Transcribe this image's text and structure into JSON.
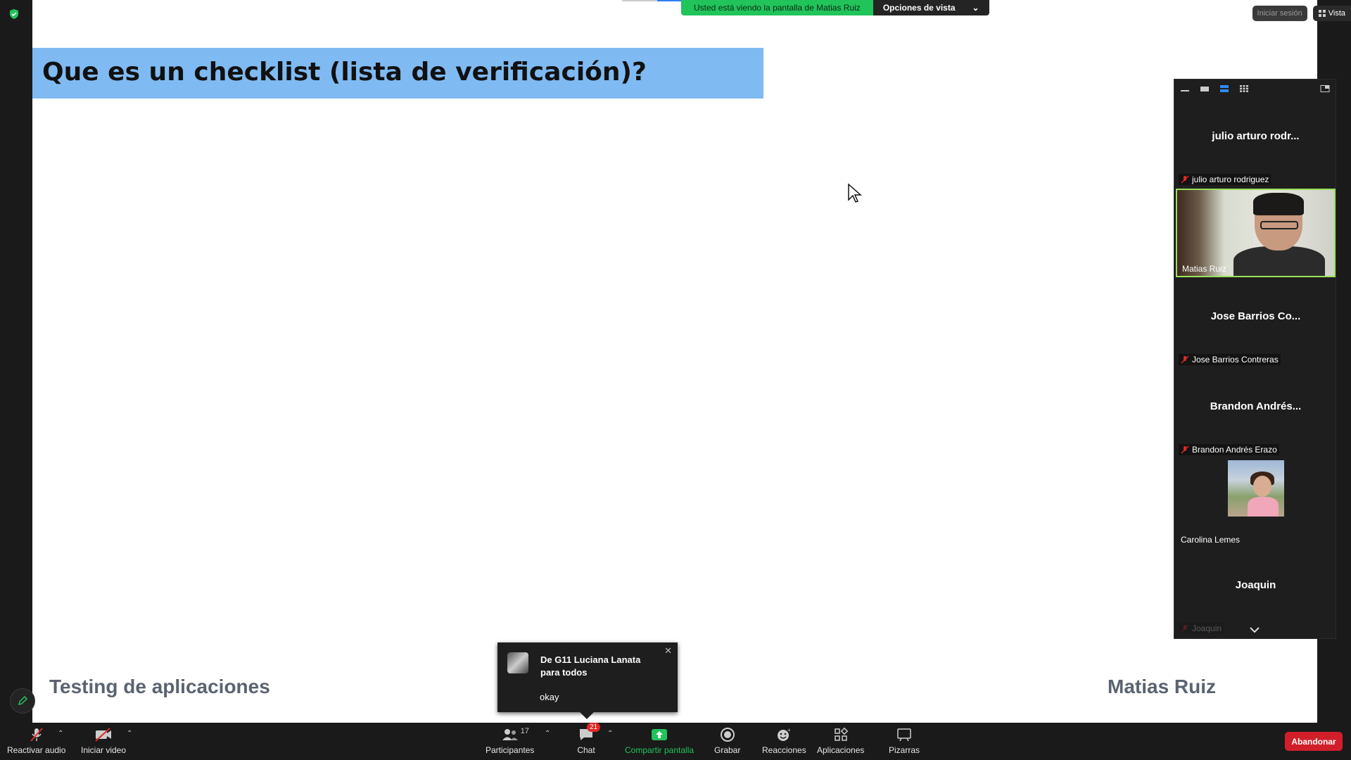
{
  "security_icon_color": "#21c45a",
  "slide": {
    "title": "Que es un checklist (lista de verificación)?",
    "footer_left": "Testing de aplicaciones",
    "footer_right": "Matias Ruiz",
    "title_bar_color": "#7fbaf2"
  },
  "share_banner": {
    "viewing_text": "Usted está viendo la pantalla de  Matias Ruiz",
    "options_label": "Opciones de vista"
  },
  "top_right": {
    "signin_label": "Iniciar sesión",
    "view_label": "Vista"
  },
  "gallery": {
    "tiles": [
      {
        "display_name": "julio arturo rodr...",
        "label": "julio arturo rodriguez",
        "muted": true
      },
      {
        "display_name": "",
        "label": "Matias Ruiz",
        "muted": false,
        "video": true
      },
      {
        "display_name": "Jose Barrios Co...",
        "label": "Jose Barrios Contreras",
        "muted": true
      },
      {
        "display_name": "Brandon Andrés...",
        "label": "Brandon Andrés Erazo",
        "muted": true
      },
      {
        "display_name": "",
        "label": "Carolina Lemes",
        "muted": false,
        "photo": true
      },
      {
        "display_name": "Joaquin",
        "label": "Joaquin",
        "muted": true
      }
    ]
  },
  "chat_popup": {
    "from": "De G11 Luciana Lanata para todos",
    "message": "okay"
  },
  "toolbar": {
    "audio_label": "Reactivar audio",
    "video_label": "Iniciar video",
    "participants_label": "Participantes",
    "participants_count": "17",
    "chat_label": "Chat",
    "chat_badge": "21",
    "share_label": "Compartir pantalla",
    "record_label": "Grabar",
    "reactions_label": "Reacciones",
    "apps_label": "Aplicaciones",
    "whiteboards_label": "Pizarras",
    "leave_label": "Abandonar"
  }
}
